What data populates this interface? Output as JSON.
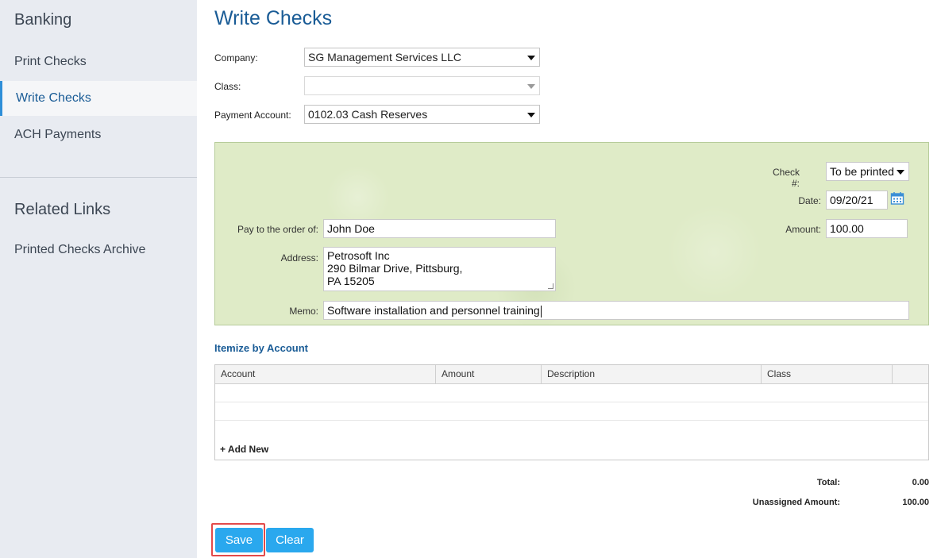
{
  "sidebar": {
    "heading": "Banking",
    "items": [
      {
        "label": "Print Checks"
      },
      {
        "label": "Write Checks"
      },
      {
        "label": "ACH Payments"
      }
    ],
    "related_heading": "Related Links",
    "related_items": [
      {
        "label": "Printed Checks Archive"
      }
    ]
  },
  "page": {
    "title": "Write Checks"
  },
  "form": {
    "company_label": "Company:",
    "company_value": "SG Management Services LLC",
    "class_label": "Class:",
    "class_value": "",
    "payment_account_label": "Payment Account:",
    "payment_account_value": "0102.03 Cash Reserves"
  },
  "check": {
    "check_no_label": "Check #:",
    "check_no_value": "To be printed",
    "date_label": "Date:",
    "date_value": "09/20/21",
    "pay_to_label": "Pay to the order of:",
    "pay_to_value": "John Doe",
    "amount_label": "Amount:",
    "amount_value": "100.00",
    "address_label": "Address:",
    "address_lines": [
      "Petrosoft Inc",
      "290 Bilmar Drive, Pittsburg,",
      "PA 15205"
    ],
    "memo_label": "Memo:",
    "memo_value": "Software installation and personnel training"
  },
  "itemize": {
    "title": "Itemize by Account",
    "columns": [
      "Account",
      "Amount",
      "Description",
      "Class"
    ],
    "add_new": "+ Add New"
  },
  "totals": {
    "total_label": "Total:",
    "total_value": "0.00",
    "unassigned_label": "Unassigned Amount:",
    "unassigned_value": "100.00"
  },
  "buttons": {
    "save": "Save",
    "clear": "Clear"
  },
  "colors": {
    "accent": "#1a5c96",
    "button": "#2aa8ee",
    "check_bg": "#dfebc7",
    "highlight": "#e34a4a"
  }
}
